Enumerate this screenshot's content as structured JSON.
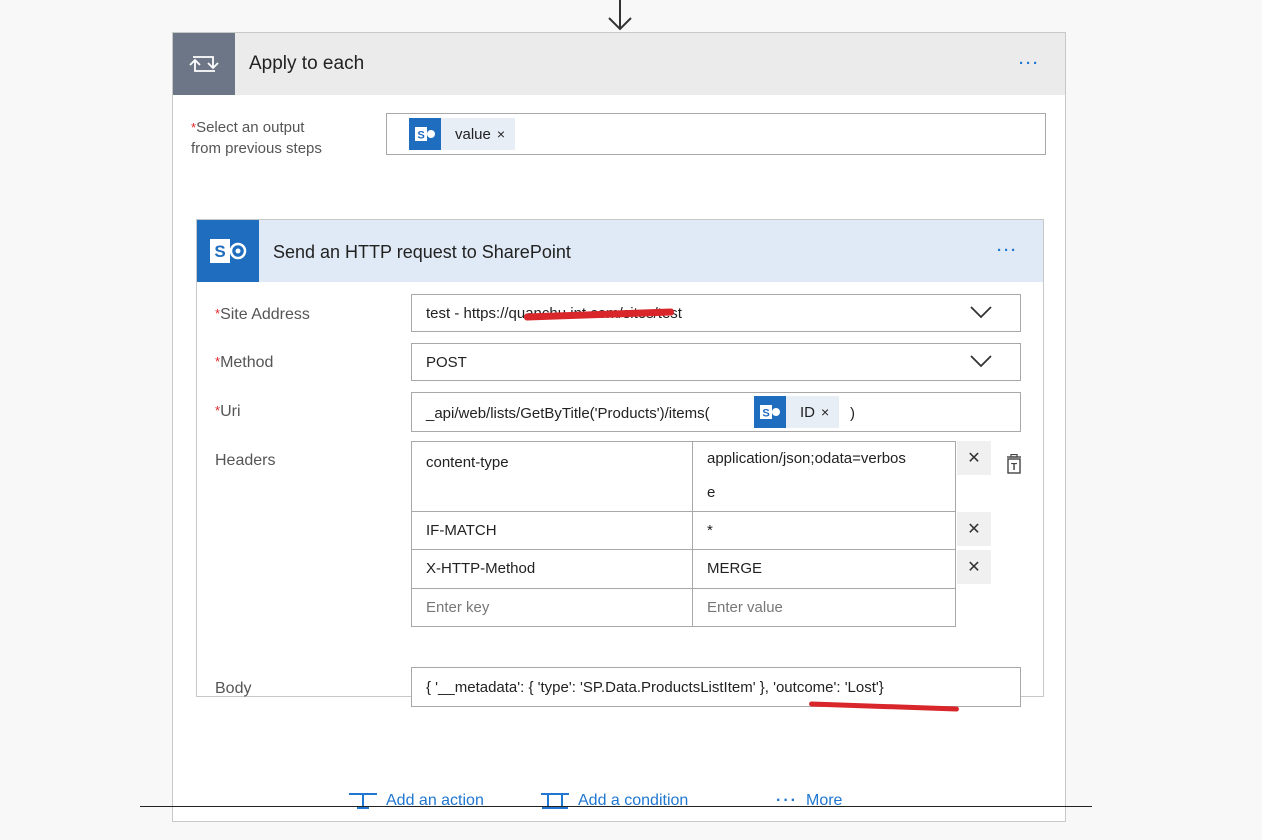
{
  "scope": {
    "title": "Apply to each",
    "select_label_line1": "Select an output",
    "select_label_line2": "from previous steps",
    "required_mark": "*",
    "token": {
      "label": "value",
      "remove": "×"
    },
    "more": "···"
  },
  "action": {
    "title": "Send an HTTP request to SharePoint",
    "more": "···",
    "fields": {
      "site_address": {
        "label": "Site Address",
        "value": "test - https://quanchu                        int.com/sites/test"
      },
      "method": {
        "label": "Method",
        "value": "POST"
      },
      "uri": {
        "label": "Uri",
        "prefix": "_api/web/lists/GetByTitle('Products')/items(",
        "token": "ID",
        "token_remove": "×",
        "suffix": ")"
      },
      "headers": {
        "label": "Headers",
        "rows": [
          {
            "key": "content-type",
            "value_line1": "application/json;odata=verbos",
            "value_line2": "e"
          },
          {
            "key": "IF-MATCH",
            "value": "*"
          },
          {
            "key": "X-HTTP-Method",
            "value": "MERGE"
          }
        ],
        "key_placeholder": "Enter key",
        "value_placeholder": "Enter value",
        "remove": "✕"
      },
      "body": {
        "label": "Body",
        "value": "{ '__metadata': { 'type': 'SP.Data.ProductsListItem' }, 'outcome': 'Lost'}"
      }
    }
  },
  "footer": {
    "add_action": "Add an action",
    "add_condition": "Add a condition",
    "more": "More"
  },
  "colors": {
    "accent": "#1f6dbf",
    "link": "#1f77d0",
    "required": "#e02424",
    "redaction": "#d9262a"
  }
}
